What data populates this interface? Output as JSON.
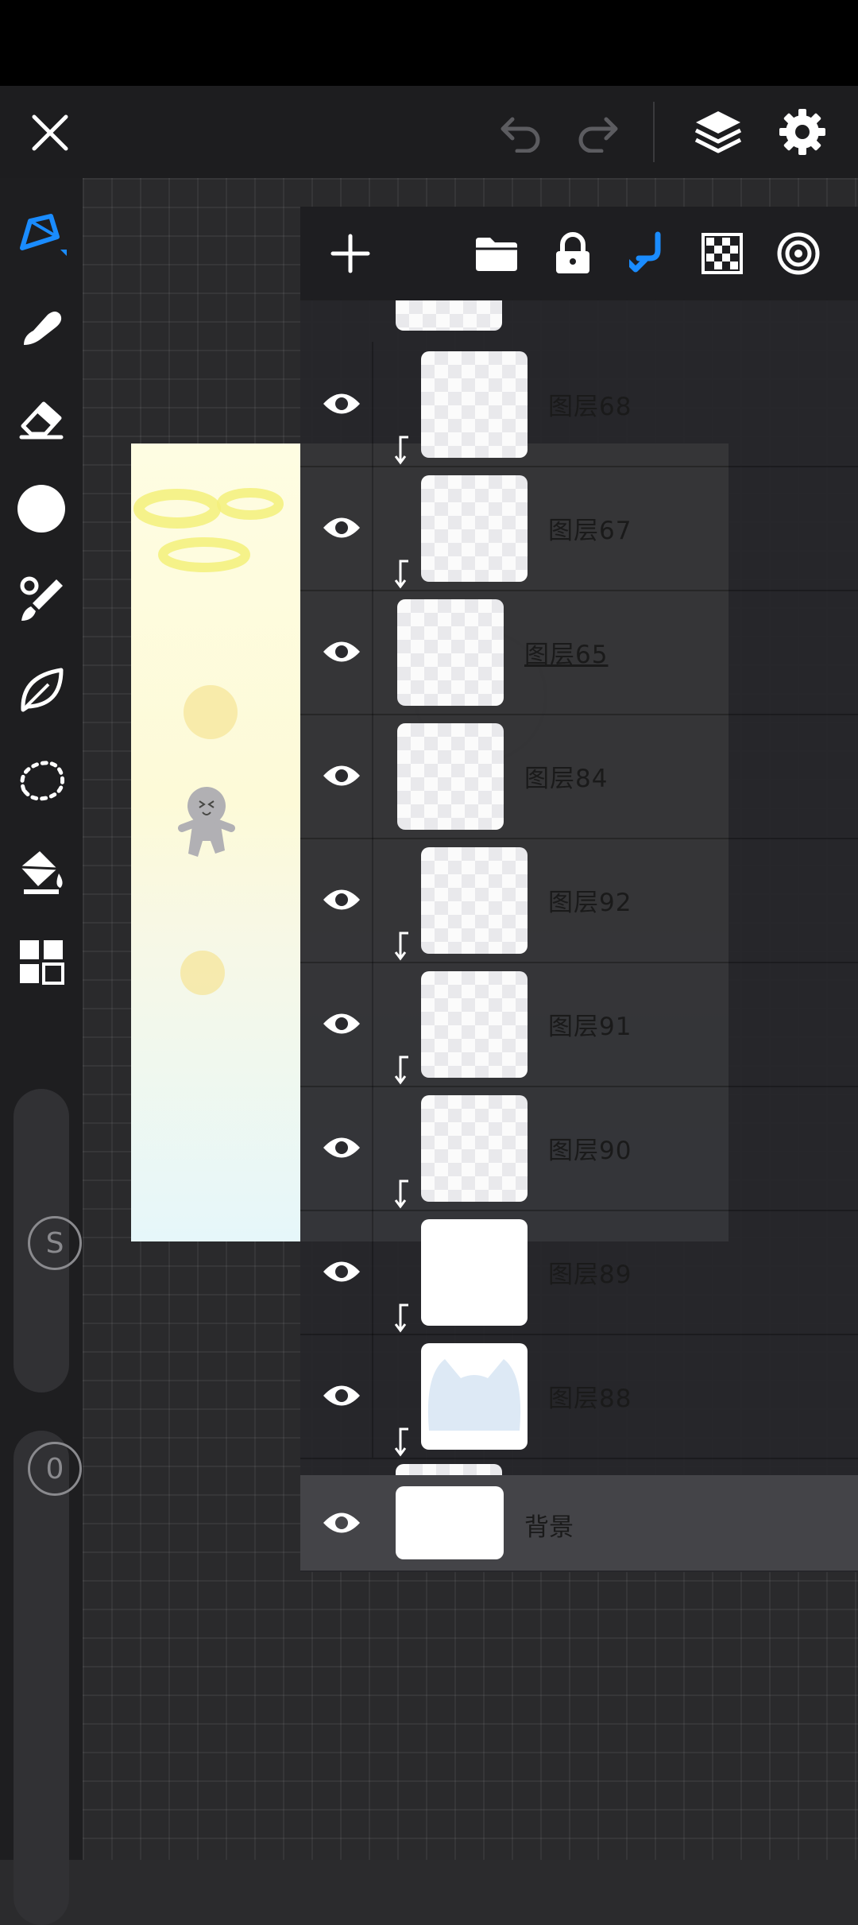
{
  "app": {
    "status_bar_color": "#000000",
    "accent_color": "#1a8cff",
    "topbar": {
      "close_icon": "close-icon",
      "undo_icon": "undo-icon",
      "redo_icon": "redo-icon",
      "layers_icon": "layers-icon",
      "settings_icon": "gear-icon"
    },
    "tools": [
      {
        "name": "pen-tool",
        "icon": "pen-icon",
        "active": true
      },
      {
        "name": "smudge-tool",
        "icon": "smudge-icon",
        "active": false
      },
      {
        "name": "eraser-tool",
        "icon": "eraser-icon",
        "active": false
      },
      {
        "name": "color-swatch",
        "icon": "color-circle-icon",
        "active": false
      },
      {
        "name": "brush-tool",
        "icon": "brush-icon",
        "active": false
      },
      {
        "name": "lasso-fill-tool",
        "icon": "leaf-icon",
        "active": false
      },
      {
        "name": "selection-tool",
        "icon": "dotted-lasso-icon",
        "active": false
      },
      {
        "name": "fill-tool",
        "icon": "paint-bucket-icon",
        "active": false
      },
      {
        "name": "more-tools",
        "icon": "grid-icon",
        "active": false
      }
    ],
    "size_slider_label": "S",
    "opacity_slider_label": "0",
    "layers_panel": {
      "toolbar_icons": [
        "add-icon",
        "folder-icon",
        "lock-icon",
        "clipping-mask-icon",
        "alpha-lock-icon",
        "reference-icon"
      ],
      "layers": [
        {
          "name": "图层68",
          "visible": true,
          "clipped": true
        },
        {
          "name": "图层67",
          "visible": true,
          "clipped": true
        },
        {
          "name": "图层65",
          "visible": true,
          "clipped": false,
          "selected": true
        },
        {
          "name": "图层84",
          "visible": true,
          "clipped": false
        },
        {
          "name": "图层92",
          "visible": true,
          "clipped": true
        },
        {
          "name": "图层91",
          "visible": true,
          "clipped": true
        },
        {
          "name": "图层90",
          "visible": true,
          "clipped": true
        },
        {
          "name": "图层89",
          "visible": true,
          "clipped": true
        },
        {
          "name": "图层88",
          "visible": true,
          "clipped": true
        }
      ],
      "background_layer": {
        "name": "背景",
        "visible": true
      }
    }
  }
}
